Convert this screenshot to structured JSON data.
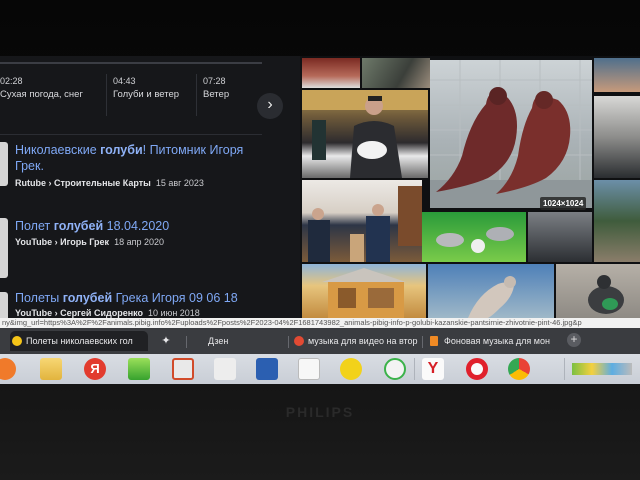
{
  "browser": {
    "video_strip": [
      {
        "time": "02:28",
        "caption": "Сухая погода, снег"
      },
      {
        "time": "04:43",
        "caption": "Голуби и ветер"
      },
      {
        "time": "07:28",
        "caption": "Ветер"
      }
    ],
    "next_icon": "chevron-right-icon",
    "results": [
      {
        "title_pre": "Николаевские ",
        "title_hl": "голуби",
        "title_post": "! Питомник Игоря Грек.",
        "source": "Rutube › Строительные Карты",
        "date": "15 авг 2023"
      },
      {
        "title_pre": "Полет ",
        "title_hl": "голубей",
        "title_post": " 18.04.2020",
        "source": "YouTube › Игорь Грек",
        "date": "18 апр 2020"
      },
      {
        "title_pre": "Полеты ",
        "title_hl": "голубей",
        "title_post": " Грека Игоря 09 06 18",
        "source": "YouTube › Сергей Сидоренко",
        "date": "10 июн 2018"
      }
    ],
    "image_size_badge": "1024×1024",
    "status_url": "ny&img_url=https%3A%2F%2Fanimals.pibig.info%2Fuploads%2Fposts%2F2023-04%2F1681743982_animals-pibig-info-p-golubi-kazanskie-pantsirnie-zhivotnie-pint-46.jpg&p",
    "tabs": [
      {
        "label": "Полеты николаевских гол",
        "icon": "yandex-video-icon",
        "active": true
      },
      {
        "label": "",
        "icon": "sparkle-icon",
        "active": false
      },
      {
        "label": "Дзен",
        "icon": "",
        "active": false
      },
      {
        "label": "музыка для видео на втор",
        "icon": "yandex-music-icon",
        "active": false
      },
      {
        "label": "Фоновая музыка для мон",
        "icon": "music-bars-icon",
        "active": false
      }
    ]
  },
  "taskbar": {
    "icons": [
      "media-player-icon",
      "folder-icon",
      "yandex-browser-icon",
      "download-icon",
      "video-editor-icon",
      "audio-icon",
      "word-icon",
      "file-icon",
      "scribble-icon",
      "yandex-logo-icon",
      "y-letter-icon",
      "opera-icon",
      "chrome-icon"
    ]
  },
  "monitor": {
    "brand": "PHILIPS"
  },
  "colors": {
    "link": "#7fa8f5",
    "background": "#16171a",
    "taskbar": "#d0d5dc"
  }
}
